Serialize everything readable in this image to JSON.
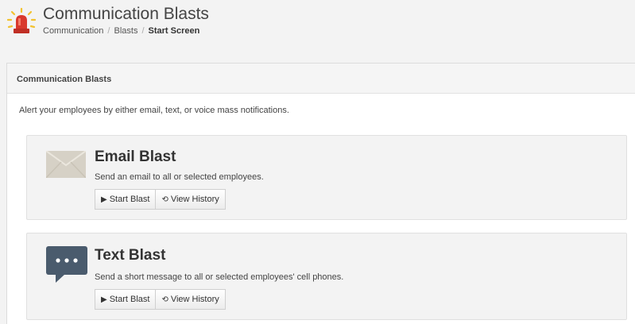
{
  "header": {
    "title": "Communication Blasts",
    "breadcrumb": [
      "Communication",
      "Blasts",
      "Start Screen"
    ],
    "icon": "alarm-beacon-icon"
  },
  "panel": {
    "heading": "Communication Blasts",
    "intro": "Alert your employees by either email, text, or voice mass notifications."
  },
  "cards": [
    {
      "icon": "envelope-icon",
      "title": "Email Blast",
      "description": "Send an email to all or selected employees.",
      "start_label": "Start Blast",
      "history_label": "View History"
    },
    {
      "icon": "chat-bubble-icon",
      "title": "Text Blast",
      "description": "Send a short message to all or selected employees' cell phones.",
      "start_label": "Start Blast",
      "history_label": "View History"
    }
  ],
  "colors": {
    "beacon_red": "#d9382c",
    "beacon_yellow": "#f2c230",
    "icon_envelope": "#d6d1c6",
    "icon_chat": "#4a5b6d"
  }
}
